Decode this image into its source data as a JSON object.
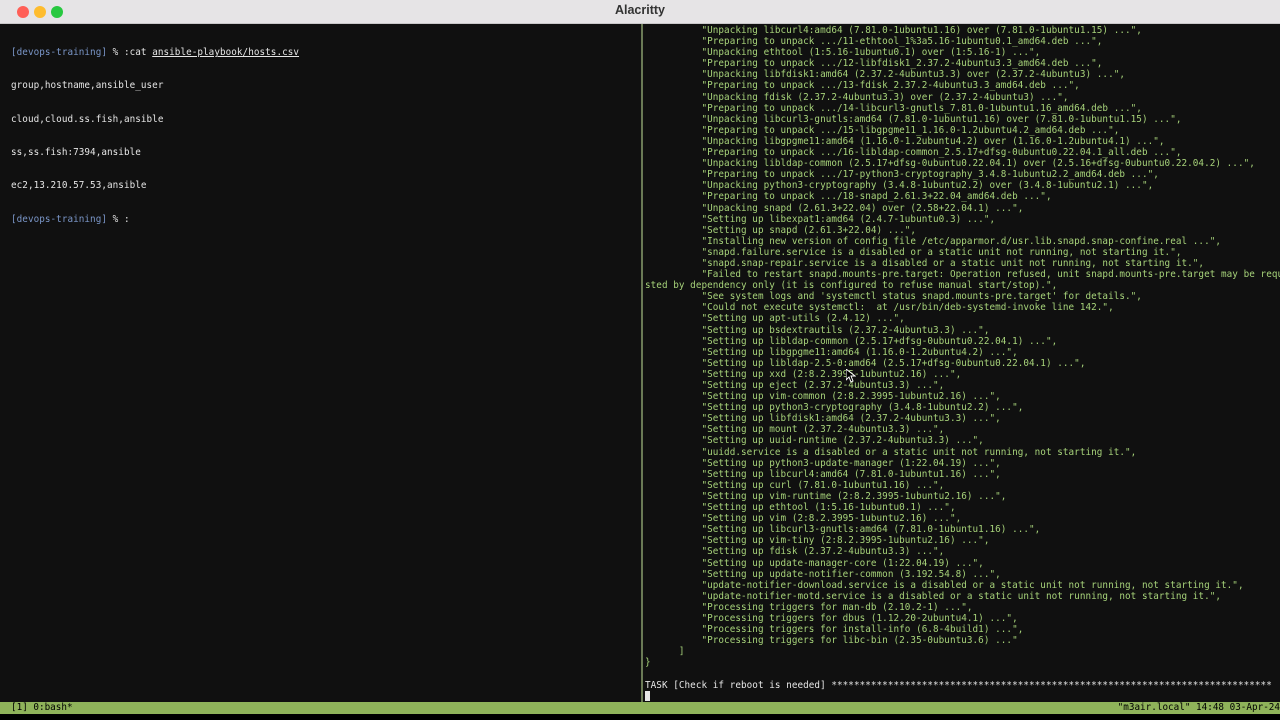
{
  "window": {
    "title": "Alacritty"
  },
  "left_pane": {
    "prompt": "[devops-training]",
    "prompt_suffix": " % :",
    "cmd_prefix": "cat ",
    "cmd_file": "ansible-playbook/hosts.csv",
    "output": [
      "group,hostname,ansible_user",
      "cloud,cloud.ss.fish,ansible",
      "ss,ss.fish:7394,ansible",
      "ec2,13.210.57.53,ansible"
    ]
  },
  "right_pane": {
    "lines": [
      "          \"Unpacking libcurl4:amd64 (7.81.0-1ubuntu1.16) over (7.81.0-1ubuntu1.15) ...\",",
      "          \"Preparing to unpack .../11-ethtool_1%3a5.16-1ubuntu0.1_amd64.deb ...\",",
      "          \"Unpacking ethtool (1:5.16-1ubuntu0.1) over (1:5.16-1) ...\",",
      "          \"Preparing to unpack .../12-libfdisk1_2.37.2-4ubuntu3.3_amd64.deb ...\",",
      "          \"Unpacking libfdisk1:amd64 (2.37.2-4ubuntu3.3) over (2.37.2-4ubuntu3) ...\",",
      "          \"Preparing to unpack .../13-fdisk_2.37.2-4ubuntu3.3_amd64.deb ...\",",
      "          \"Unpacking fdisk (2.37.2-4ubuntu3.3) over (2.37.2-4ubuntu3) ...\",",
      "          \"Preparing to unpack .../14-libcurl3-gnutls_7.81.0-1ubuntu1.16_amd64.deb ...\",",
      "          \"Unpacking libcurl3-gnutls:amd64 (7.81.0-1ubuntu1.16) over (7.81.0-1ubuntu1.15) ...\",",
      "          \"Preparing to unpack .../15-libgpgme11_1.16.0-1.2ubuntu4.2_amd64.deb ...\",",
      "          \"Unpacking libgpgme11:amd64 (1.16.0-1.2ubuntu4.2) over (1.16.0-1.2ubuntu4.1) ...\",",
      "          \"Preparing to unpack .../16-libldap-common_2.5.17+dfsg-0ubuntu0.22.04.1_all.deb ...\",",
      "          \"Unpacking libldap-common (2.5.17+dfsg-0ubuntu0.22.04.1) over (2.5.16+dfsg-0ubuntu0.22.04.2) ...\",",
      "          \"Preparing to unpack .../17-python3-cryptography_3.4.8-1ubuntu2.2_amd64.deb ...\",",
      "          \"Unpacking python3-cryptography (3.4.8-1ubuntu2.2) over (3.4.8-1ubuntu2.1) ...\",",
      "          \"Preparing to unpack .../18-snapd_2.61.3+22.04_amd64.deb ...\",",
      "          \"Unpacking snapd (2.61.3+22.04) over (2.58+22.04.1) ...\",",
      "          \"Setting up libexpat1:amd64 (2.4.7-1ubuntu0.3) ...\",",
      "          \"Setting up snapd (2.61.3+22.04) ...\",",
      "          \"Installing new version of config file /etc/apparmor.d/usr.lib.snapd.snap-confine.real ...\",",
      "          \"snapd.failure.service is a disabled or a static unit not running, not starting it.\",",
      "          \"snapd.snap-repair.service is a disabled or a static unit not running, not starting it.\",",
      "          \"Failed to restart snapd.mounts-pre.target: Operation refused, unit snapd.mounts-pre.target may be reque",
      "sted by dependency only (it is configured to refuse manual start/stop).\",",
      "          \"See system logs and 'systemctl status snapd.mounts-pre.target' for details.\",",
      "          \"Could not execute systemctl:  at /usr/bin/deb-systemd-invoke line 142.\",",
      "          \"Setting up apt-utils (2.4.12) ...\",",
      "          \"Setting up bsdextrautils (2.37.2-4ubuntu3.3) ...\",",
      "          \"Setting up libldap-common (2.5.17+dfsg-0ubuntu0.22.04.1) ...\",",
      "          \"Setting up libgpgme11:amd64 (1.16.0-1.2ubuntu4.2) ...\",",
      "          \"Setting up libldap-2.5-0:amd64 (2.5.17+dfsg-0ubuntu0.22.04.1) ...\",",
      "          \"Setting up xxd (2:8.2.3995-1ubuntu2.16) ...\",",
      "          \"Setting up eject (2.37.2-4ubuntu3.3) ...\",",
      "          \"Setting up vim-common (2:8.2.3995-1ubuntu2.16) ...\",",
      "          \"Setting up python3-cryptography (3.4.8-1ubuntu2.2) ...\",",
      "          \"Setting up libfdisk1:amd64 (2.37.2-4ubuntu3.3) ...\",",
      "          \"Setting up mount (2.37.2-4ubuntu3.3) ...\",",
      "          \"Setting up uuid-runtime (2.37.2-4ubuntu3.3) ...\",",
      "          \"uuidd.service is a disabled or a static unit not running, not starting it.\",",
      "          \"Setting up python3-update-manager (1:22.04.19) ...\",",
      "          \"Setting up libcurl4:amd64 (7.81.0-1ubuntu1.16) ...\",",
      "          \"Setting up curl (7.81.0-1ubuntu1.16) ...\",",
      "          \"Setting up vim-runtime (2:8.2.3995-1ubuntu2.16) ...\",",
      "          \"Setting up ethtool (1:5.16-1ubuntu0.1) ...\",",
      "          \"Setting up vim (2:8.2.3995-1ubuntu2.16) ...\",",
      "          \"Setting up libcurl3-gnutls:amd64 (7.81.0-1ubuntu1.16) ...\",",
      "          \"Setting up vim-tiny (2:8.2.3995-1ubuntu2.16) ...\",",
      "          \"Setting up fdisk (2.37.2-4ubuntu3.3) ...\",",
      "          \"Setting up update-manager-core (1:22.04.19) ...\",",
      "          \"Setting up update-notifier-common (3.192.54.8) ...\",",
      "          \"update-notifier-download.service is a disabled or a static unit not running, not starting it.\",",
      "          \"update-notifier-motd.service is a disabled or a static unit not running, not starting it.\",",
      "          \"Processing triggers for man-db (2.10.2-1) ...\",",
      "          \"Processing triggers for dbus (1.12.20-2ubuntu4.1) ...\",",
      "          \"Processing triggers for install-info (6.8-4build1) ...\",",
      "          \"Processing triggers for libc-bin (2.35-0ubuntu3.6) ...\"",
      "      ]",
      "}",
      ""
    ],
    "task_line": "TASK [Check if reboot is needed] ******************************************************************************"
  },
  "status_bar": {
    "left": "[1] 0:bash*",
    "right": "\"m3air.local\" 14:48 03-Apr-24"
  },
  "colors": {
    "status_bg": "#8fb35a",
    "ansible_output": "#a7d37a",
    "prompt": "#7a96c8"
  }
}
